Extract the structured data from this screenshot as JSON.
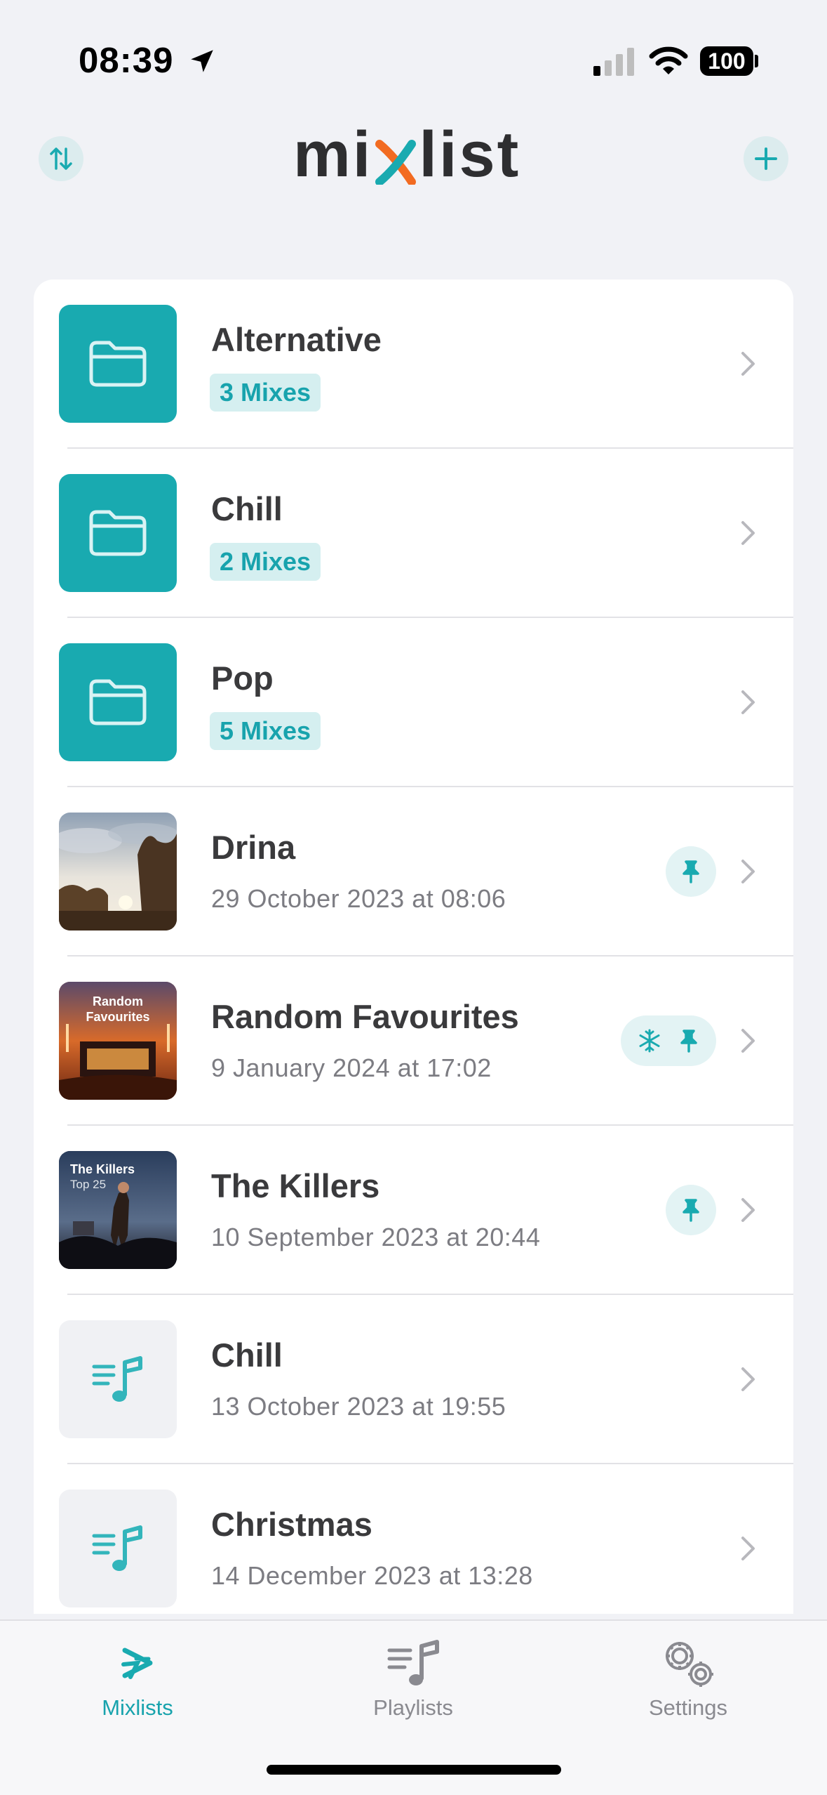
{
  "status_bar": {
    "time": "08:39",
    "battery": "100"
  },
  "header": {
    "logo_left": "mi",
    "logo_right": "list"
  },
  "rows": [
    {
      "title": "Alternative",
      "badge": "3 Mixes"
    },
    {
      "title": "Chill",
      "badge": "2 Mixes"
    },
    {
      "title": "Pop",
      "badge": "5 Mixes"
    },
    {
      "title": "Drina",
      "subtitle": "29 October 2023 at 08:06"
    },
    {
      "title": "Random Favourites",
      "subtitle": "9 January 2024 at 17:02",
      "thumb_caption_line1": "Random",
      "thumb_caption_line2": "Favourites"
    },
    {
      "title": "The Killers",
      "subtitle": "10 September 2023 at 20:44",
      "thumb_caption_line1": "The Killers",
      "thumb_caption_line2": "Top 25"
    },
    {
      "title": "Chill",
      "subtitle": "13 October 2023 at 19:55"
    },
    {
      "title": "Christmas",
      "subtitle": "14 December 2023 at 13:28"
    }
  ],
  "tabs": [
    {
      "label": "Mixlists",
      "icon": "mixlists-icon",
      "active": true
    },
    {
      "label": "Playlists",
      "icon": "playlists-icon",
      "active": false
    },
    {
      "label": "Settings",
      "icon": "gears-icon",
      "active": false
    }
  ],
  "colors": {
    "accent": "#19aab0",
    "badge_bg": "#d5eff0",
    "logo_orange": "#f26b21"
  }
}
